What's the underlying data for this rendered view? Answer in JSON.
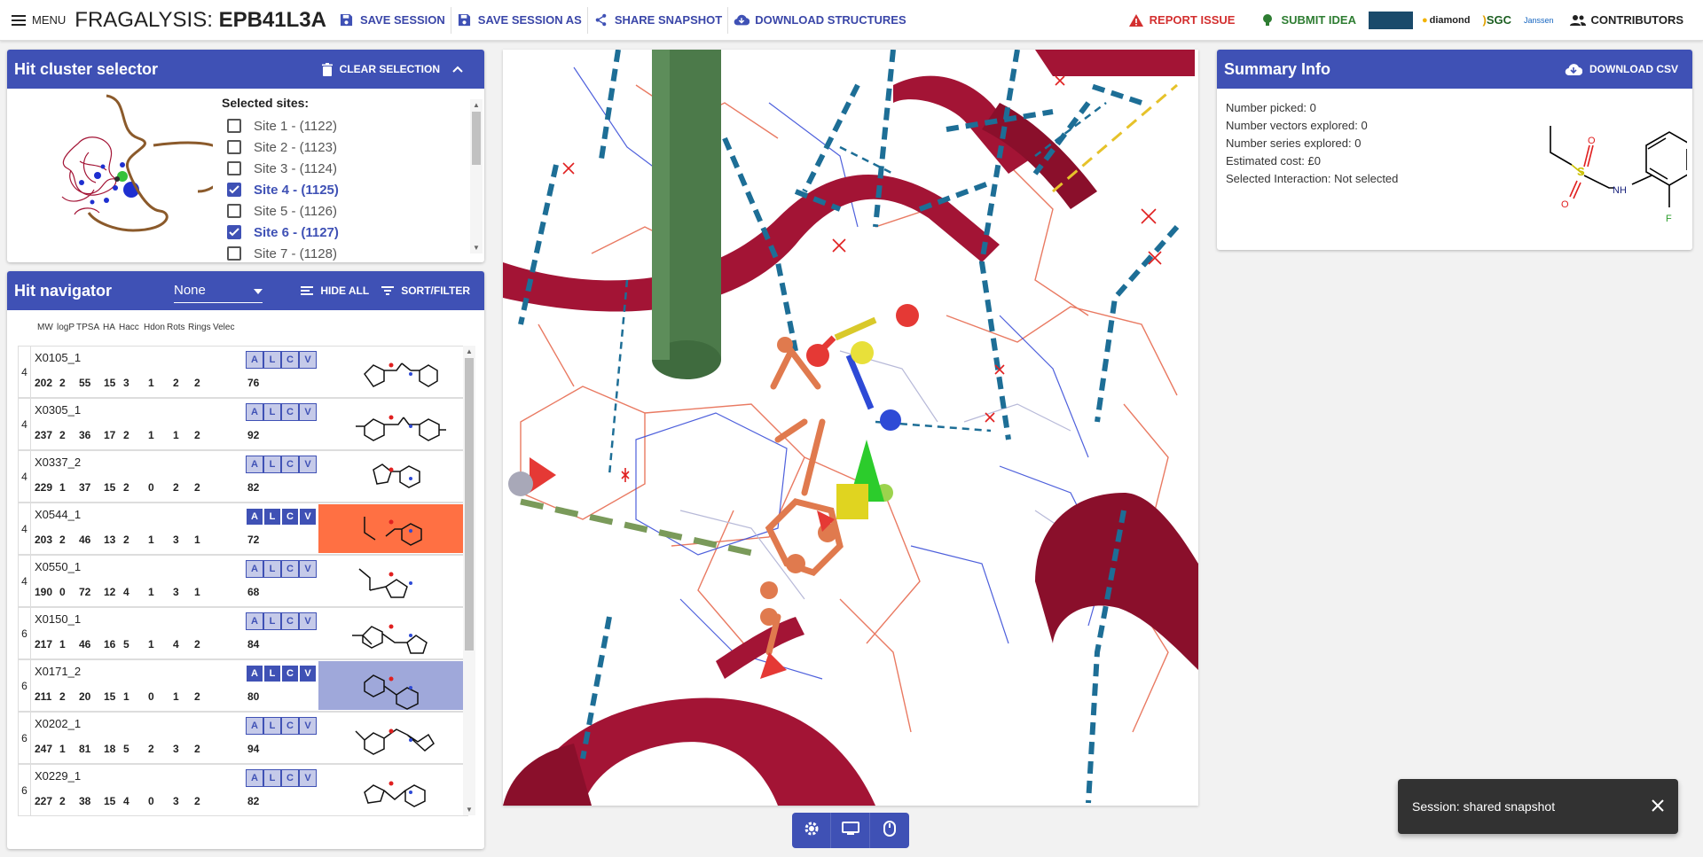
{
  "app": {
    "menu_label": "MENU",
    "brand_prefix": "FRAGALYSIS: ",
    "target": "EPB41L3A"
  },
  "toolbar": {
    "save_session": "SAVE SESSION",
    "save_session_as": "SAVE SESSION AS",
    "share_snapshot": "SHARE SNAPSHOT",
    "download_structures": "DOWNLOAD STRUCTURES",
    "report_issue": "REPORT ISSUE",
    "submit_idea": "SUBMIT IDEA",
    "contributors": "CONTRIBUTORS",
    "logos": [
      "diamond",
      "SGC",
      "Janssen"
    ]
  },
  "cluster": {
    "title": "Hit cluster selector",
    "clear_label": "CLEAR SELECTION",
    "selected_label": "Selected sites:",
    "sites": [
      {
        "label": "Site 1 - (1122)",
        "checked": false
      },
      {
        "label": "Site 2 - (1123)",
        "checked": false
      },
      {
        "label": "Site 3 - (1124)",
        "checked": false
      },
      {
        "label": "Site 4 - (1125)",
        "checked": true
      },
      {
        "label": "Site 5 - (1126)",
        "checked": false
      },
      {
        "label": "Site 6 - (1127)",
        "checked": true
      },
      {
        "label": "Site 7 - (1128)",
        "checked": false
      }
    ]
  },
  "navigator": {
    "title": "Hit navigator",
    "select_value": "None",
    "hide_all_label": "HIDE ALL",
    "sort_filter_label": "SORT/FILTER",
    "columns": [
      "MW",
      "logP",
      "TPSA",
      "HA",
      "Hacc",
      "Hdon",
      "Rots",
      "Rings",
      "Velec"
    ],
    "hits": [
      {
        "site": "4",
        "code": "X0105_1",
        "props": [
          "202",
          "2",
          "55",
          "15",
          "3",
          "1",
          "2",
          "2"
        ],
        "velec": "76",
        "active": false,
        "highlight": ""
      },
      {
        "site": "4",
        "code": "X0305_1",
        "props": [
          "237",
          "2",
          "36",
          "17",
          "2",
          "1",
          "1",
          "2"
        ],
        "velec": "92",
        "active": false,
        "highlight": ""
      },
      {
        "site": "4",
        "code": "X0337_2",
        "props": [
          "229",
          "1",
          "37",
          "15",
          "2",
          "0",
          "2",
          "2"
        ],
        "velec": "82",
        "active": false,
        "highlight": ""
      },
      {
        "site": "4",
        "code": "X0544_1",
        "props": [
          "203",
          "2",
          "46",
          "13",
          "2",
          "1",
          "3",
          "1"
        ],
        "velec": "72",
        "active": true,
        "highlight": "#ff7043"
      },
      {
        "site": "4",
        "code": "X0550_1",
        "props": [
          "190",
          "0",
          "72",
          "12",
          "4",
          "1",
          "3",
          "1"
        ],
        "velec": "68",
        "active": false,
        "highlight": ""
      },
      {
        "site": "6",
        "code": "X0150_1",
        "props": [
          "217",
          "1",
          "46",
          "16",
          "5",
          "1",
          "4",
          "2"
        ],
        "velec": "84",
        "active": false,
        "highlight": ""
      },
      {
        "site": "6",
        "code": "X0171_2",
        "props": [
          "211",
          "2",
          "20",
          "15",
          "1",
          "0",
          "1",
          "2"
        ],
        "velec": "80",
        "active": true,
        "highlight": "#9fa8da"
      },
      {
        "site": "6",
        "code": "X0202_1",
        "props": [
          "247",
          "1",
          "81",
          "18",
          "5",
          "2",
          "3",
          "2"
        ],
        "velec": "94",
        "active": false,
        "highlight": ""
      },
      {
        "site": "6",
        "code": "X0229_1",
        "props": [
          "227",
          "2",
          "38",
          "15",
          "4",
          "0",
          "3",
          "2"
        ],
        "velec": "82",
        "active": false,
        "highlight": ""
      }
    ],
    "alcv": [
      "A",
      "L",
      "C",
      "V"
    ]
  },
  "summary": {
    "title": "Summary Info",
    "download_label": "DOWNLOAD CSV",
    "lines": [
      "Number picked: 0",
      "Number vectors explored: 0",
      "Number series explored: 0",
      "Estimated cost: £0",
      "Selected Interaction: Not selected"
    ],
    "mol_labels": {
      "nh": "NH",
      "f": "F"
    }
  },
  "snackbar": {
    "message": "Session: shared snapshot"
  },
  "colors": {
    "primary": "#3f51b5",
    "report": "#d32f2f",
    "submit": "#2e7d32",
    "ribbon": "#a31435"
  }
}
